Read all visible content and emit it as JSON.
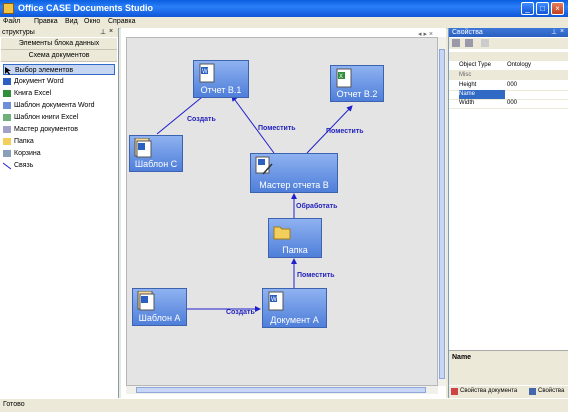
{
  "window": {
    "title": "Office CASE Documents Studio"
  },
  "menu": [
    "Файл",
    "Правка",
    "Вид",
    "Окно",
    "Справка"
  ],
  "left_panel": {
    "header": "структуры",
    "tabs": [
      "Элементы блока данных",
      "Схема документов"
    ],
    "tools": [
      {
        "label": "Выбор элементов",
        "icon": "pointer-icon"
      },
      {
        "label": "Документ Word",
        "icon": "word-doc-icon"
      },
      {
        "label": "Книга Excel",
        "icon": "excel-book-icon"
      },
      {
        "label": "Шаблон документа Word",
        "icon": "word-template-icon"
      },
      {
        "label": "Шаблон книги Excel",
        "icon": "excel-template-icon"
      },
      {
        "label": "Мастер документов",
        "icon": "wizard-icon"
      },
      {
        "label": "Папка",
        "icon": "folder-icon"
      },
      {
        "label": "Корзина",
        "icon": "trash-icon"
      },
      {
        "label": "Связь",
        "icon": "link-icon"
      }
    ]
  },
  "diagram": {
    "nodes": {
      "report_b1": "Отчет В.1",
      "report_b2": "Отчет В.2",
      "template_c": "Шаблон С",
      "master_b": "Мастер отчета В",
      "folder": "Папка",
      "template_a": "Шаблон А",
      "document_a": "Документ А"
    },
    "edges": {
      "create_top": "Создать",
      "place_b1": "Поместить",
      "place_b2": "Поместить",
      "process": "Обработать",
      "place_folder": "Поместить",
      "create_bottom": "Создать"
    }
  },
  "right_panel": {
    "header": "Свойства",
    "section_misc": "Misc",
    "rows": [
      {
        "key": "Object Type",
        "value": "Ontology"
      },
      {
        "key": "Height",
        "value": "000"
      },
      {
        "key": "Name",
        "value": ""
      },
      {
        "key": "Width",
        "value": "000"
      }
    ],
    "desc_title": "Name",
    "tabs": [
      "Свойства документа",
      "Свойства"
    ]
  },
  "status": {
    "text": "Готово"
  },
  "colors": {
    "node_fill": "#6a93e4",
    "edge": "#1f1fcc",
    "titlebar": "#0a5fe0"
  }
}
